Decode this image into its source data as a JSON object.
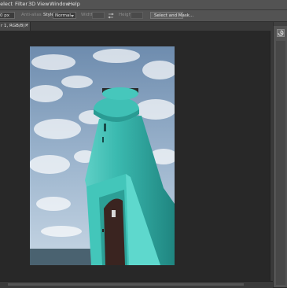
{
  "menu": [
    "Select",
    "Filter",
    "3D",
    "View",
    "Window",
    "Help"
  ],
  "options": {
    "tolerance_value": "0 px",
    "anti_alias_label": "Anti-alias",
    "style_label": "Style:",
    "style_value": "Normal",
    "width_label": "Width:",
    "height_label": "Height:",
    "select_mask_label": "Select and Mask..."
  },
  "document": {
    "tab_label": "r 1, RGB/8) *",
    "close_glyph": "×"
  },
  "colors": {
    "sky_top": "#6e8cae",
    "sky_bottom": "#c7d6e4",
    "lighthouse_teal": "#34b3aa",
    "sea": "#4a6270"
  },
  "icons": [
    "swap-arrows-icon",
    "history-icon",
    "chevron-down-icon",
    "close-icon"
  ]
}
